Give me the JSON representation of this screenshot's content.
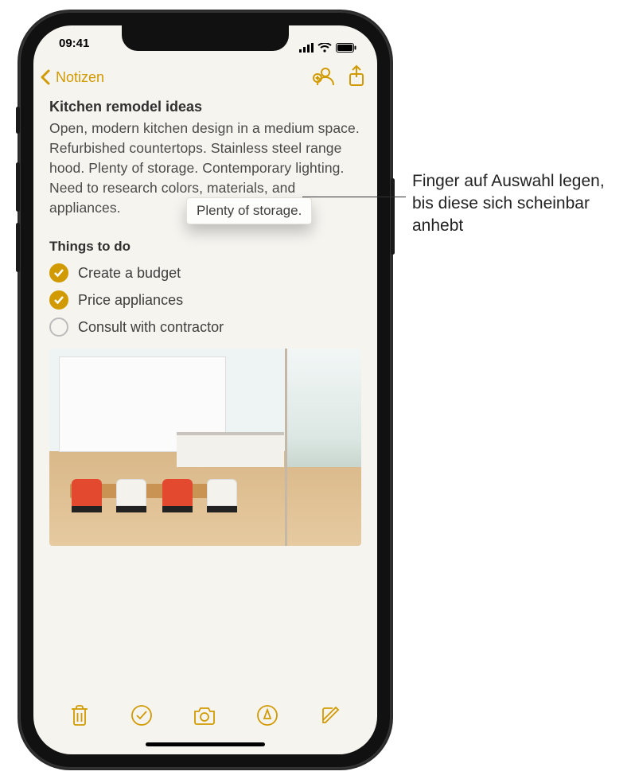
{
  "statusbar": {
    "time": "09:41"
  },
  "nav": {
    "back_label": "Notizen"
  },
  "note": {
    "title": "Kitchen remodel ideas",
    "body": "Open, modern kitchen design in a medium space. Refurbished countertops. Stainless steel range hood. Plenty of storage. Contemporary lighting. Need to research colors, materials, and appliances.",
    "subhead": "Things to do",
    "items": [
      {
        "label": "Create a budget",
        "checked": true
      },
      {
        "label": "Price appliances",
        "checked": true
      },
      {
        "label": "Consult with contractor",
        "checked": false
      }
    ]
  },
  "drag": {
    "lifted_text": "Plenty of storage."
  },
  "callout": {
    "text": "Finger auf Auswahl legen, bis diese sich scheinbar anhebt"
  },
  "colors": {
    "accent": "#d19a00"
  }
}
